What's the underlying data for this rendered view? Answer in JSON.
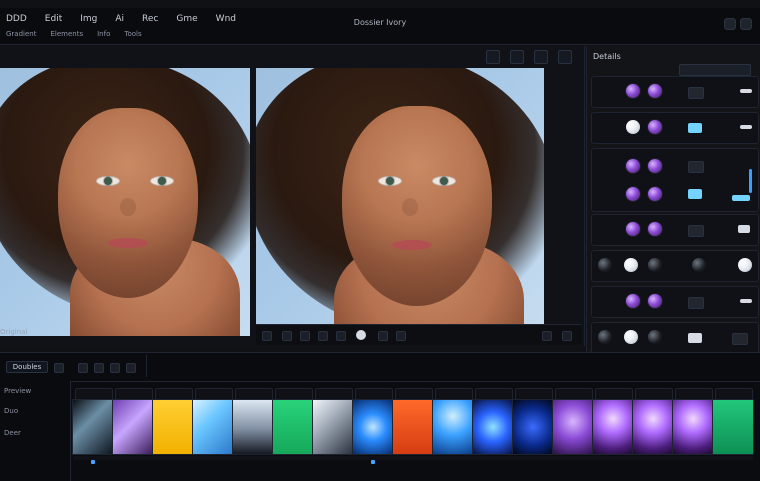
{
  "window": {
    "title": "Dossier Ivory",
    "menu": [
      "DDD",
      "Edit",
      "Img",
      "Ai",
      "Rec",
      "Gme",
      "Wnd"
    ],
    "submenu": [
      "Gradient",
      "Elements",
      "Info",
      "Tools"
    ]
  },
  "viewer": {
    "caption": "Original",
    "controls": [
      "frame",
      "zoom",
      "reset",
      "fit",
      "play",
      "more",
      "split",
      "export"
    ]
  },
  "panel": {
    "title": "Details"
  },
  "timeline": {
    "mode_label": "Doubles",
    "track_labels": [
      "Preview",
      "Duo",
      "Deer"
    ]
  }
}
